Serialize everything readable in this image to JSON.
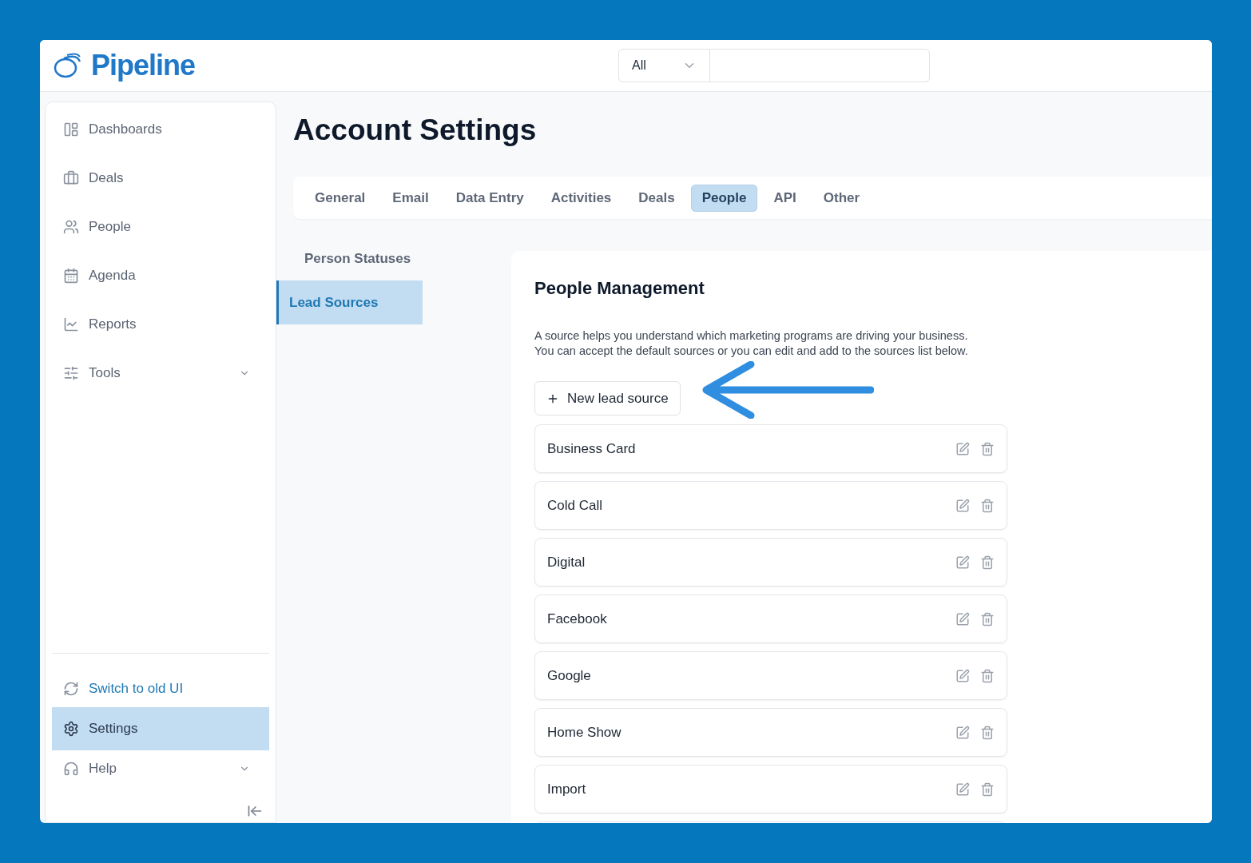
{
  "brand": "Pipeline",
  "search": {
    "scope": "All"
  },
  "sidebar": {
    "items": [
      {
        "label": "Dashboards",
        "selected": false,
        "expandable": false
      },
      {
        "label": "Deals",
        "selected": false,
        "expandable": false
      },
      {
        "label": "People",
        "selected": false,
        "expandable": false
      },
      {
        "label": "Agenda",
        "selected": false,
        "expandable": false
      },
      {
        "label": "Reports",
        "selected": false,
        "expandable": false
      },
      {
        "label": "Tools",
        "selected": false,
        "expandable": true
      }
    ],
    "bottom_items": [
      {
        "label": "Switch to old UI",
        "kind": "link",
        "selected": false,
        "expandable": false
      },
      {
        "label": "Settings",
        "kind": "nav",
        "selected": true,
        "expandable": false
      },
      {
        "label": "Help",
        "kind": "nav",
        "selected": false,
        "expandable": true
      }
    ]
  },
  "page_title": "Account Settings",
  "tabs": [
    {
      "label": "General",
      "selected": false
    },
    {
      "label": "Email",
      "selected": false
    },
    {
      "label": "Data Entry",
      "selected": false
    },
    {
      "label": "Activities",
      "selected": false
    },
    {
      "label": "Deals",
      "selected": false
    },
    {
      "label": "People",
      "selected": true
    },
    {
      "label": "API",
      "selected": false
    },
    {
      "label": "Other",
      "selected": false
    }
  ],
  "subnav": [
    {
      "label": "Person Statuses",
      "selected": false
    },
    {
      "label": "Lead Sources",
      "selected": true
    }
  ],
  "panel": {
    "title": "People Management",
    "description": [
      "A source helps you understand which marketing programs are driving your business.",
      "You can accept the default sources or you can edit and add to the sources list below."
    ],
    "new_button": "New lead source",
    "sources": [
      "Business Card",
      "Cold Call",
      "Digital",
      "Facebook",
      "Google",
      "Home Show",
      "Import"
    ]
  }
}
